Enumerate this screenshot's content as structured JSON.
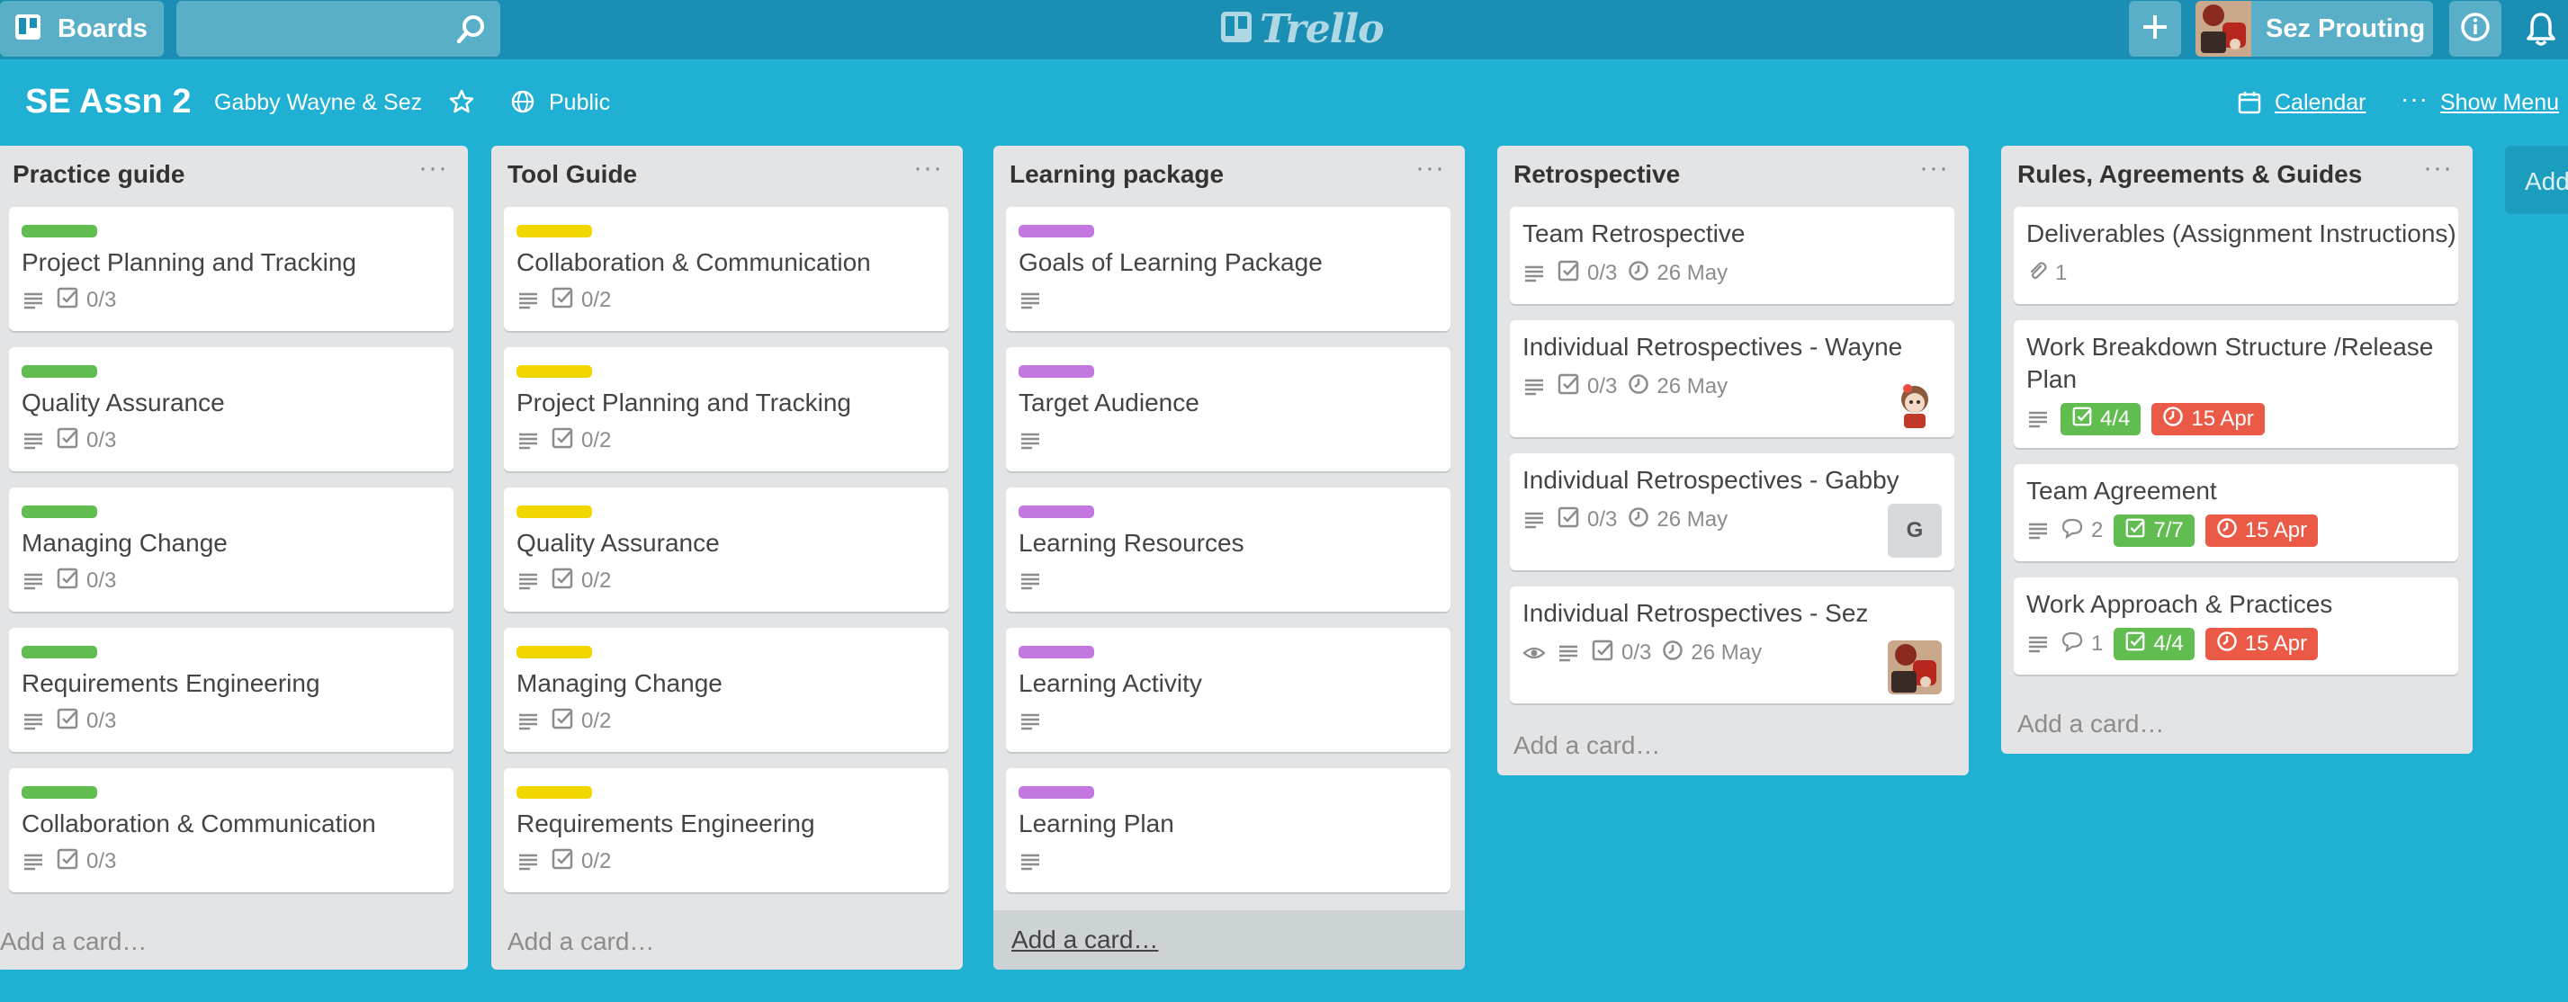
{
  "header": {
    "boards_label": "Boards",
    "search_value": "",
    "logo_text": "Trello",
    "user_name": "Sez Prouting"
  },
  "board": {
    "title": "SE Assn 2",
    "team": "Gabby Wayne & Sez",
    "visibility": "Public",
    "calendar_label": "Calendar",
    "show_menu_label": "Show Menu",
    "add_list_label": "Add"
  },
  "colors": {
    "header_bg": "#1a8fb3",
    "board_bg": "#1fb0d4",
    "label_green": "#61bd4f",
    "label_yellow": "#f2d600",
    "label_purple": "#c377e0",
    "badge_complete": "#61bd4f",
    "badge_due_past": "#eb5a46"
  },
  "lists": [
    {
      "title": "Practice guide",
      "add_card": "Add a card…",
      "cards": [
        {
          "title": "Project Planning and Tracking",
          "checklist": "0/3"
        },
        {
          "title": "Quality Assurance",
          "checklist": "0/3"
        },
        {
          "title": "Managing Change",
          "checklist": "0/3"
        },
        {
          "title": "Requirements Engineering",
          "checklist": "0/3"
        },
        {
          "title": "Collaboration & Communication",
          "checklist": "0/3"
        }
      ]
    },
    {
      "title": "Tool Guide",
      "add_card": "Add a card…",
      "cards": [
        {
          "title": "Collaboration & Communication",
          "checklist": "0/2"
        },
        {
          "title": "Project Planning and Tracking",
          "checklist": "0/2"
        },
        {
          "title": "Quality Assurance",
          "checklist": "0/2"
        },
        {
          "title": "Managing Change",
          "checklist": "0/2"
        },
        {
          "title": "Requirements Engineering",
          "checklist": "0/2"
        }
      ]
    },
    {
      "title": "Learning package",
      "add_card": "Add a card…",
      "cards": [
        {
          "title": "Goals of Learning Package"
        },
        {
          "title": "Target Audience"
        },
        {
          "title": "Learning Resources"
        },
        {
          "title": "Learning Activity"
        },
        {
          "title": "Learning Plan"
        }
      ]
    },
    {
      "title": "Retrospective",
      "add_card": "Add a card…",
      "cards": [
        {
          "title": "Team Retrospective",
          "checklist": "0/3",
          "due": "26 May"
        },
        {
          "title": "Individual Retrospectives - Wayne",
          "checklist": "0/3",
          "due": "26 May"
        },
        {
          "title": "Individual Retrospectives - Gabby",
          "checklist": "0/3",
          "due": "26 May",
          "member_initial": "G"
        },
        {
          "title": "Individual Retrospectives - Sez",
          "checklist": "0/3",
          "due": "26 May"
        }
      ]
    },
    {
      "title": "Rules, Agreements & Guides",
      "add_card": "Add a card…",
      "cards": [
        {
          "title": "Deliverables (Assignment Instructions)",
          "attachments": "1"
        },
        {
          "title_line1": "Work Breakdown Structure /Release",
          "title_line2": "Plan",
          "checklist": "4/4",
          "due": "15 Apr"
        },
        {
          "title": "Team Agreement",
          "comments": "2",
          "checklist": "7/7",
          "due": "15 Apr"
        },
        {
          "title": "Work Approach & Practices",
          "comments": "1",
          "checklist": "4/4",
          "due": "15 Apr"
        }
      ]
    }
  ]
}
